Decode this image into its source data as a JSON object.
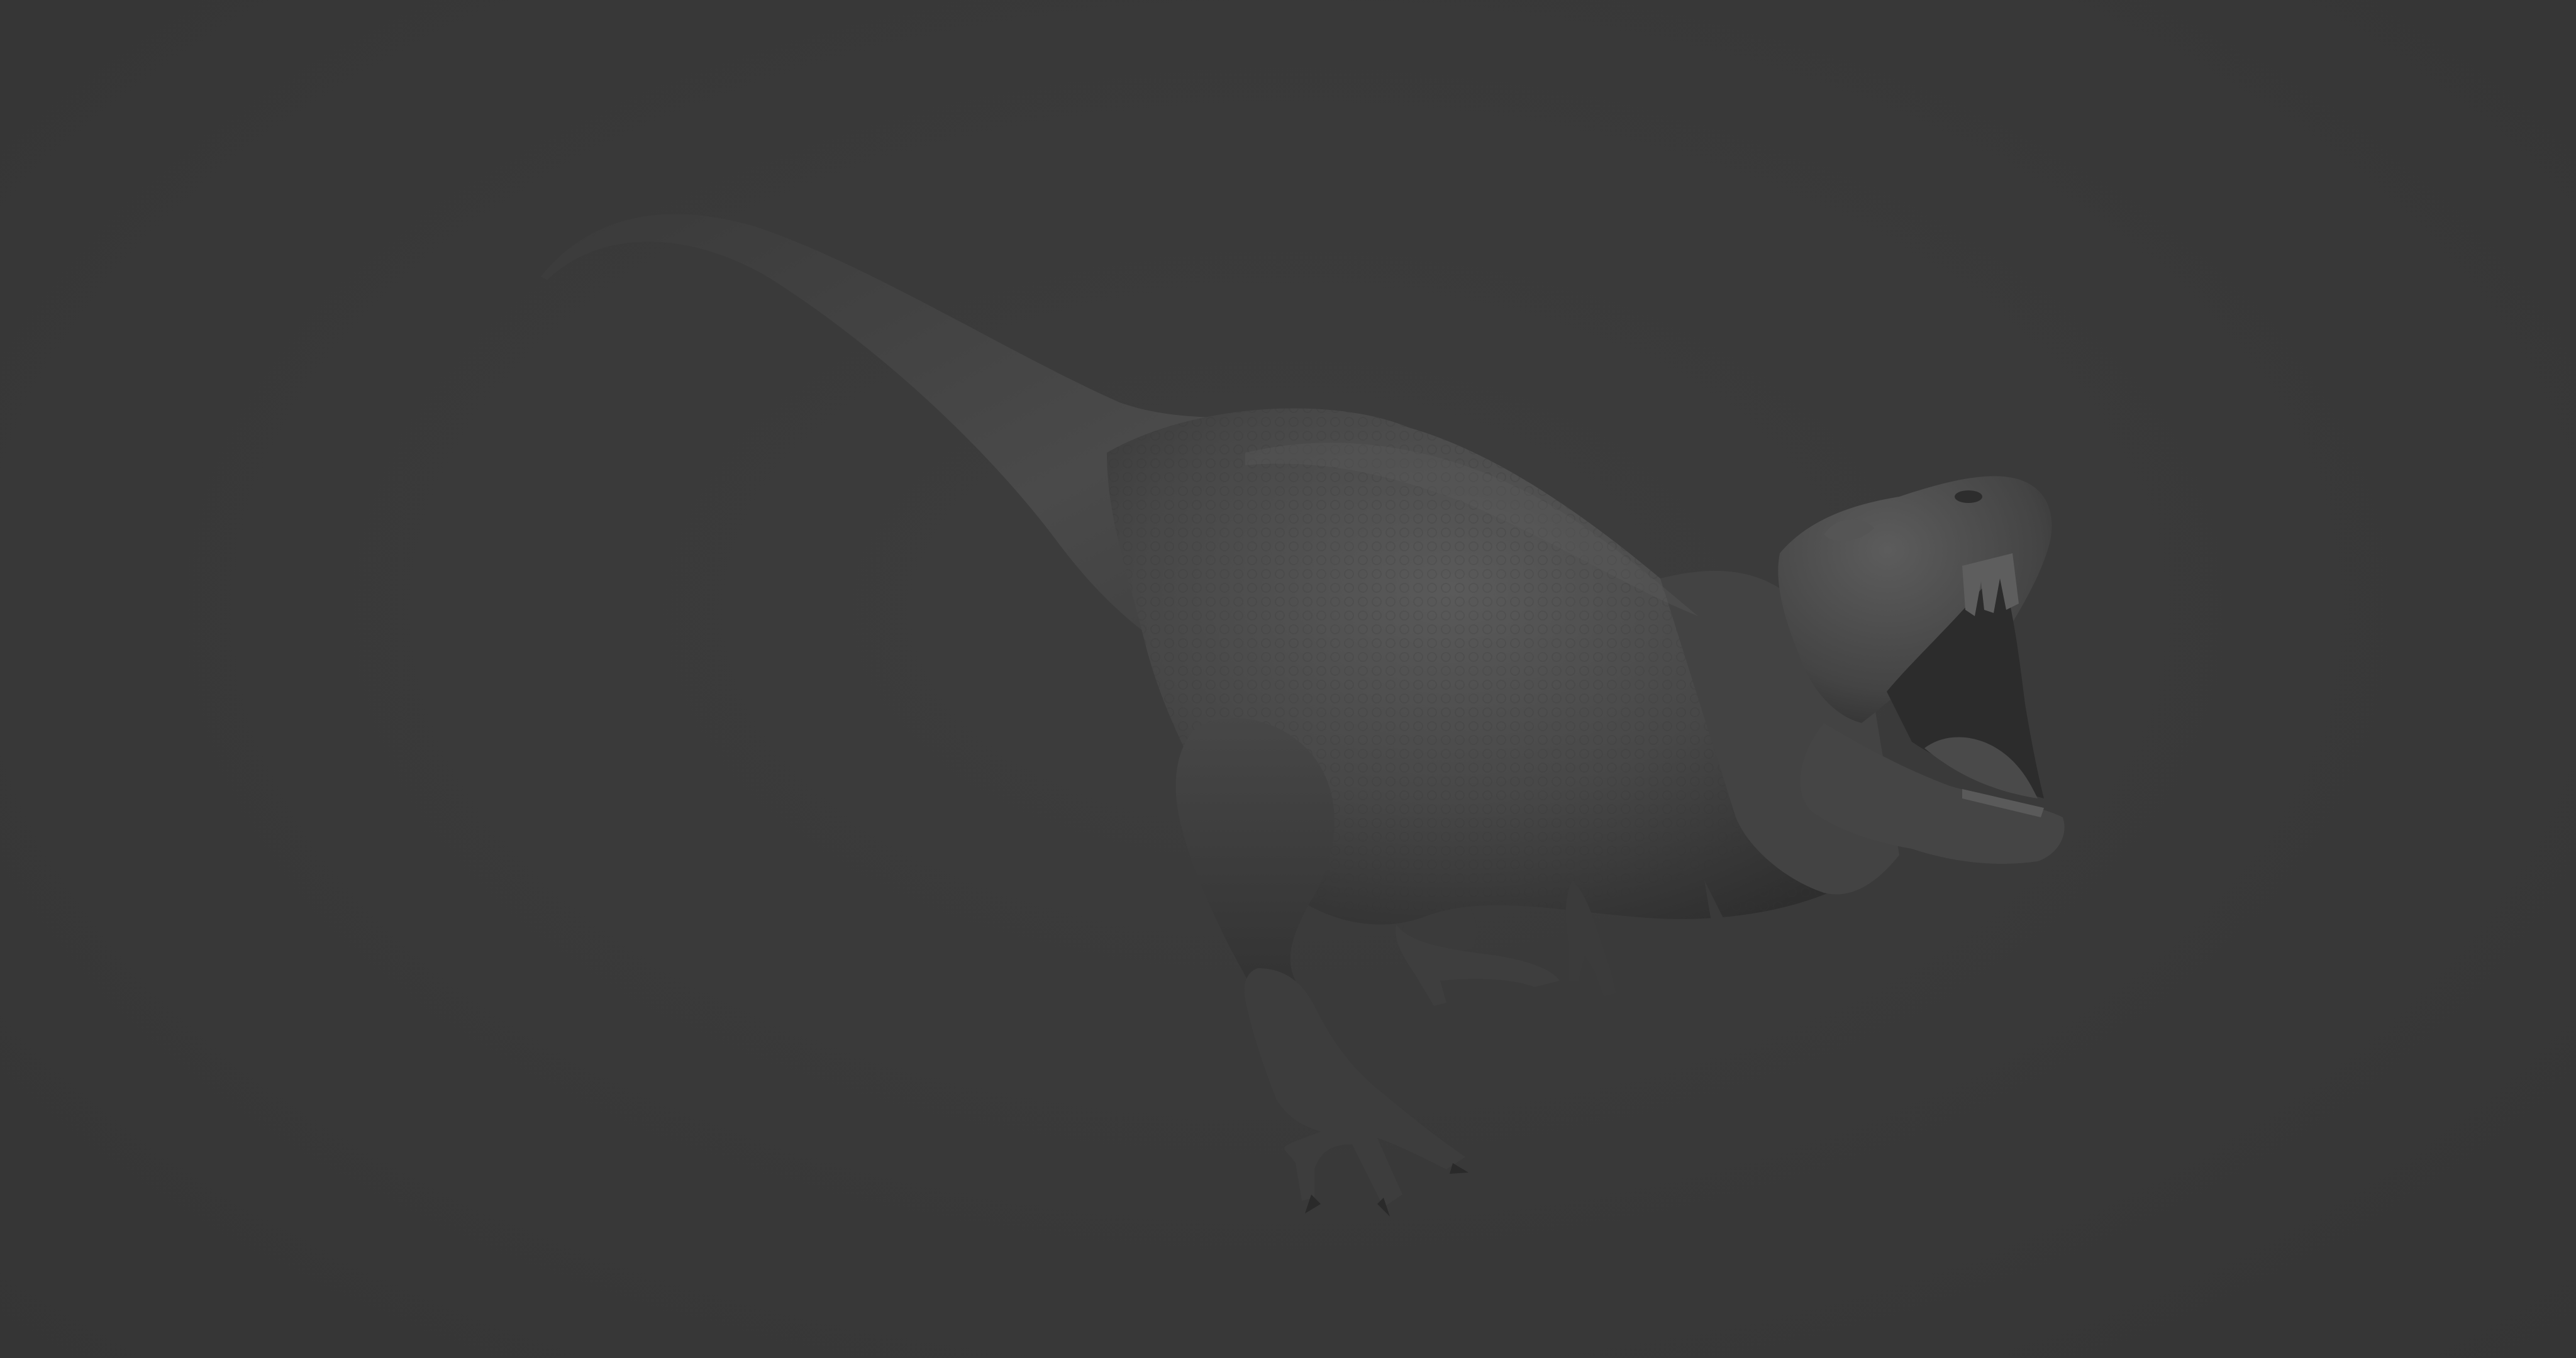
{
  "viewport": {
    "background_color": "#3a3a3a",
    "model_color": "#4a4a4a"
  },
  "model": {
    "subject": "tyrannosaurus-sculpt"
  }
}
